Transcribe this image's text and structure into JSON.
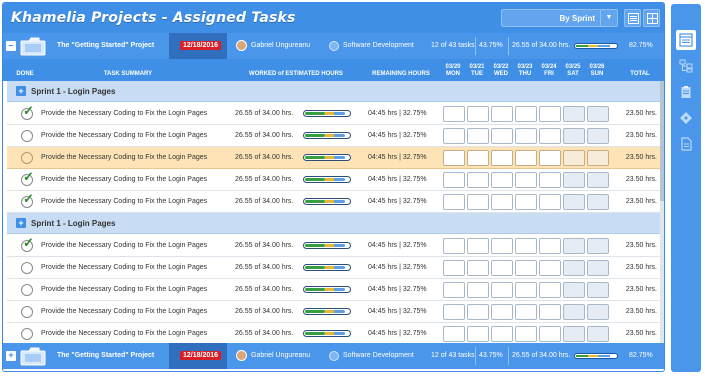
{
  "app": {
    "title": "Khamelia Projects - Assigned Tasks"
  },
  "toolbar": {
    "view_select": "By Sprint",
    "view_icon_list": "list-view-icon",
    "view_icon_grid": "grid-view-icon"
  },
  "project": {
    "name": "The \"Getting Started\" Project",
    "date": "12/18/2016",
    "user": "Gabriel Ungureanu",
    "category": "Software Development",
    "tasks": "12 of 43 tasks",
    "pct_tasks": "43.75%",
    "hours": "26.55 of 34.00 hrs.",
    "pct_hours": "82.75%",
    "progress": 0.8275
  },
  "columns": {
    "done": "DONE",
    "summary": "TASK SUMMARY",
    "worked": "WORKED of ESTIMATED HOURS",
    "remaining": "REMAINING HOURS",
    "total": "TOTAL",
    "days": [
      {
        "date": "03/20",
        "dow": "MON",
        "weekend": false
      },
      {
        "date": "03/21",
        "dow": "TUE",
        "weekend": false
      },
      {
        "date": "03/22",
        "dow": "WED",
        "weekend": false
      },
      {
        "date": "03/23",
        "dow": "THU",
        "weekend": false
      },
      {
        "date": "03/24",
        "dow": "FRI",
        "weekend": false
      },
      {
        "date": "03/25",
        "dow": "SAT",
        "weekend": true
      },
      {
        "date": "03/26",
        "dow": "SUN",
        "weekend": true
      }
    ]
  },
  "sprints": [
    {
      "title": "Sprint 1 - Login Pages",
      "tasks": [
        {
          "name": "Provide the Necessary Coding to Fix the Login Pages",
          "done": true,
          "highlight": false,
          "worked": "26.55 of 34.00 hrs.",
          "remaining": "04:45 hrs | 32.75%",
          "total": "23.50 hrs."
        },
        {
          "name": "Provide the Necessary Coding to Fix the Login Pages",
          "done": false,
          "highlight": false,
          "worked": "26.55 of 34.00 hrs.",
          "remaining": "04:45 hrs | 32.75%",
          "total": "23.50 hrs."
        },
        {
          "name": "Provide the Necessary Coding to Fix the Login Pages",
          "done": false,
          "highlight": true,
          "worked": "26.55 of 34.00 hrs.",
          "remaining": "04:45 hrs | 32.75%",
          "total": "23.50 hrs."
        },
        {
          "name": "Provide the Necessary Coding to Fix the Login Pages",
          "done": true,
          "highlight": false,
          "worked": "26.55 of 34.00 hrs.",
          "remaining": "04:45 hrs | 32.75%",
          "total": "23.50 hrs."
        },
        {
          "name": "Provide the Necessary Coding to Fix the Login Pages",
          "done": true,
          "highlight": false,
          "worked": "26.55 of 34.00 hrs.",
          "remaining": "04:45 hrs | 32.75%",
          "total": "23.50 hrs."
        }
      ]
    },
    {
      "title": "Sprint 1 - Login Pages",
      "tasks": [
        {
          "name": "Provide the Necessary Coding to Fix the Login Pages",
          "done": true,
          "highlight": false,
          "worked": "26.55 of 34.00 hrs.",
          "remaining": "04:45 hrs | 32.75%",
          "total": "23.50 hrs."
        },
        {
          "name": "Provide the Necessary Coding to Fix the Login Pages",
          "done": false,
          "highlight": false,
          "worked": "26.55 of 34.00 hrs.",
          "remaining": "04:45 hrs | 32.75%",
          "total": "23.50 hrs."
        },
        {
          "name": "Provide the Necessary Coding to Fix the Login Pages",
          "done": false,
          "highlight": false,
          "worked": "26.55 of 34.00 hrs.",
          "remaining": "04:45 hrs | 32.75%",
          "total": "23.50 hrs."
        },
        {
          "name": "Provide the Necessary Coding to Fix the Login Pages",
          "done": false,
          "highlight": false,
          "worked": "26.55 of 34.00 hrs.",
          "remaining": "04:45 hrs | 32.75%",
          "total": "23.50 hrs."
        },
        {
          "name": "Provide the Necessary Coding to Fix the Login Pages",
          "done": false,
          "highlight": false,
          "worked": "26.55 of 34.00 hrs.",
          "remaining": "04:45 hrs | 32.75%",
          "total": "23.50 hrs."
        }
      ]
    }
  ],
  "sidebar": {
    "icons": [
      "tasks-view-icon",
      "hierarchy-icon",
      "clipboard-icon",
      "tag-icon",
      "document-icon"
    ]
  },
  "colors": {
    "primary": "#3f8fe6",
    "highlight_row": "#fde3b6",
    "sprint_row": "#c8dcf3",
    "date_badge": "#d81f26",
    "done_check": "#2e8b2e"
  }
}
